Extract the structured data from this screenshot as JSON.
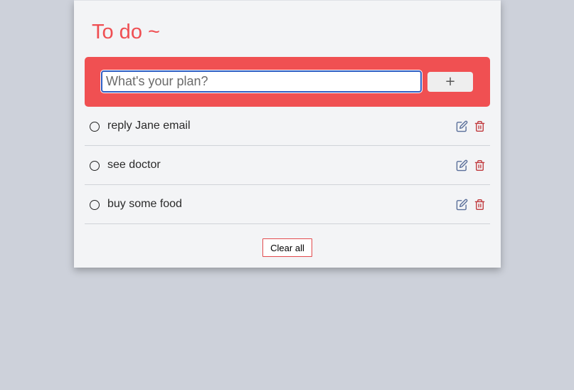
{
  "app": {
    "title": "To do ~"
  },
  "new_item": {
    "placeholder": "What's your plan?",
    "value": "",
    "add_label": "+"
  },
  "todos": [
    {
      "text": "reply Jane email",
      "done": false
    },
    {
      "text": "see doctor",
      "done": false
    },
    {
      "text": "buy some food",
      "done": false
    }
  ],
  "footer": {
    "clear_label": "Clear all"
  },
  "colors": {
    "accent": "#f05052",
    "background": "#cdd1da",
    "card": "#f3f4f6",
    "edit_icon": "#5a6f9a",
    "trash_icon": "#c0393d"
  },
  "icons": {
    "status": "empty-circle-icon",
    "edit": "edit-icon",
    "delete": "trash-icon"
  }
}
